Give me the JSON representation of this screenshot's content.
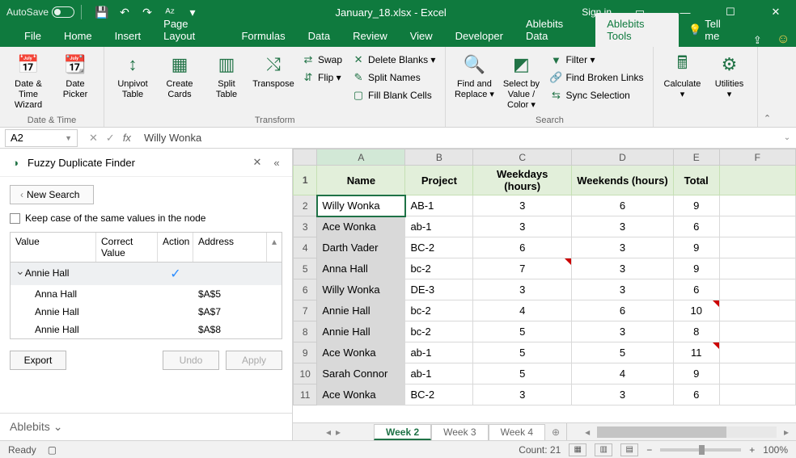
{
  "title": {
    "autosave": "AutoSave",
    "filename": "January_18.xlsx  -  Excel",
    "signin": "Sign in"
  },
  "tabs": [
    "File",
    "Home",
    "Insert",
    "Page Layout",
    "Formulas",
    "Data",
    "Review",
    "View",
    "Developer",
    "Ablebits Data",
    "Ablebits Tools"
  ],
  "active_tab": "Ablebits Tools",
  "tellme": "Tell me",
  "ribbon": {
    "groups": [
      {
        "label": "Date & Time",
        "big": [
          {
            "label": "Date &\nTime Wizard",
            "icon": "📅"
          },
          {
            "label": "Date\nPicker",
            "icon": "📆"
          }
        ]
      },
      {
        "label": "Transform",
        "big": [
          {
            "label": "Unpivot\nTable",
            "icon": "↕"
          },
          {
            "label": "Create\nCards",
            "icon": "▦"
          },
          {
            "label": "Split\nTable",
            "icon": "▥"
          },
          {
            "label": "Transpose",
            "icon": "⤭"
          }
        ],
        "small": [
          {
            "label": "Swap",
            "icon": "⇄"
          },
          {
            "label": "Flip ▾",
            "icon": "⇵"
          }
        ],
        "small2": [
          {
            "label": "Delete Blanks ▾",
            "icon": "✕"
          },
          {
            "label": "Split Names",
            "icon": "✎"
          },
          {
            "label": "Fill Blank Cells",
            "icon": "▢"
          }
        ]
      },
      {
        "label": "Search",
        "big": [
          {
            "label": "Find and\nReplace ▾",
            "icon": "🔍"
          },
          {
            "label": "Select by\nValue / Color ▾",
            "icon": "◩"
          }
        ],
        "small": [
          {
            "label": "Filter ▾",
            "icon": "▼"
          },
          {
            "label": "Find Broken Links",
            "icon": "🔗"
          },
          {
            "label": "Sync Selection",
            "icon": "⇆"
          }
        ]
      },
      {
        "label": "",
        "big": [
          {
            "label": "Calculate\n▾",
            "icon": "🖩"
          },
          {
            "label": "Utilities\n▾",
            "icon": "⚙"
          }
        ]
      }
    ]
  },
  "formulabar": {
    "namebox": "A2",
    "value": "Willy Wonka"
  },
  "taskpane": {
    "title": "Fuzzy Duplicate Finder",
    "newsearch": "New Search",
    "keepcase": "Keep case of the same values in the node",
    "cols": {
      "value": "Value",
      "correct": "Correct Value",
      "action": "Action",
      "address": "Address"
    },
    "group": "Annie Hall",
    "rows": [
      {
        "value": "Anna Hall",
        "address": "$A$5"
      },
      {
        "value": "Annie Hall",
        "address": "$A$7"
      },
      {
        "value": "Annie Hall",
        "address": "$A$8"
      }
    ],
    "buttons": {
      "export": "Export",
      "undo": "Undo",
      "apply": "Apply"
    },
    "footer": "Ablebits"
  },
  "grid": {
    "cols": [
      "A",
      "B",
      "C",
      "D",
      "E",
      "F"
    ],
    "header_row": [
      "Name",
      "Project",
      "Weekdays (hours)",
      "Weekends (hours)",
      "Total",
      ""
    ],
    "rows": [
      {
        "n": 2,
        "c": [
          "Willy Wonka",
          "AB-1",
          "3",
          "6",
          "9",
          ""
        ],
        "active": true
      },
      {
        "n": 3,
        "c": [
          "Ace Wonka",
          "ab-1",
          "3",
          "3",
          "6",
          ""
        ]
      },
      {
        "n": 4,
        "c": [
          "Darth Vader",
          "BC-2",
          "6",
          "3",
          "9",
          ""
        ]
      },
      {
        "n": 5,
        "c": [
          "Anna Hall",
          "bc-2",
          "7",
          "3",
          "9",
          ""
        ],
        "tri": 2
      },
      {
        "n": 6,
        "c": [
          "Willy Wonka",
          "DE-3",
          "3",
          "3",
          "6",
          ""
        ]
      },
      {
        "n": 7,
        "c": [
          "Annie Hall",
          "bc-2",
          "4",
          "6",
          "10",
          ""
        ],
        "tri": 4
      },
      {
        "n": 8,
        "c": [
          "Annie Hall",
          "bc-2",
          "5",
          "3",
          "8",
          ""
        ]
      },
      {
        "n": 9,
        "c": [
          "Ace Wonka",
          "ab-1",
          "5",
          "5",
          "11",
          ""
        ],
        "tri": 4
      },
      {
        "n": 10,
        "c": [
          "Sarah Connor",
          "ab-1",
          "5",
          "4",
          "9",
          ""
        ]
      },
      {
        "n": 11,
        "c": [
          "Ace Wonka",
          "BC-2",
          "3",
          "3",
          "6",
          ""
        ]
      }
    ]
  },
  "sheets": [
    "Week 2",
    "Week 3",
    "Week 4"
  ],
  "active_sheet": "Week 2",
  "status": {
    "ready": "Ready",
    "count": "Count: 21",
    "zoom": "100%"
  }
}
